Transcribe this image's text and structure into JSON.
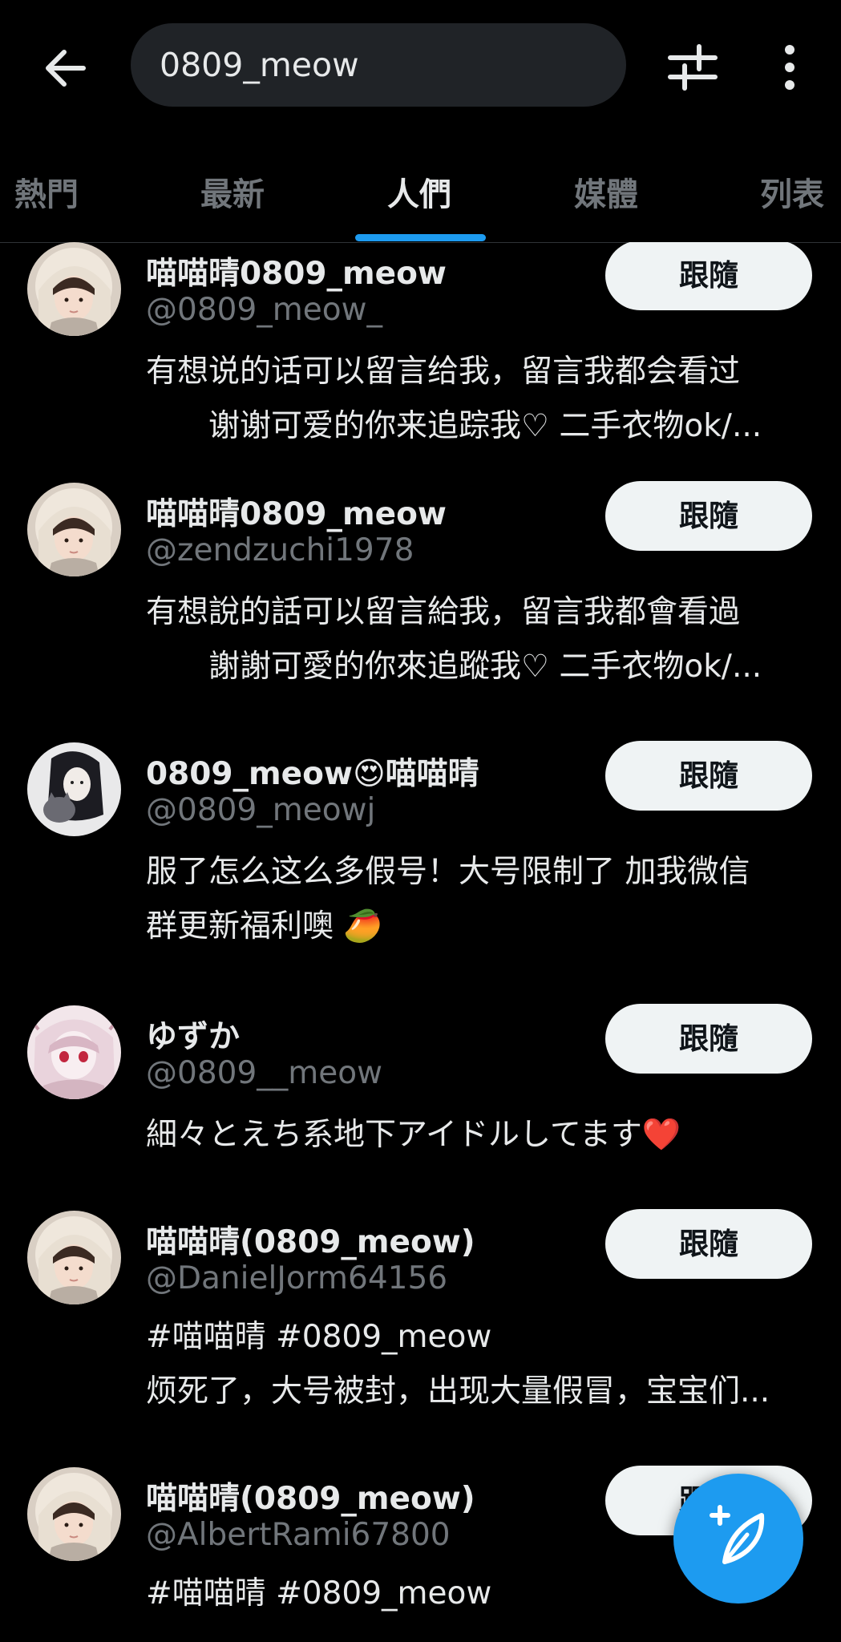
{
  "search": {
    "query": "0809_meow"
  },
  "tabs": [
    {
      "label": "熱門"
    },
    {
      "label": "最新"
    },
    {
      "label": "人們"
    },
    {
      "label": "媒體"
    },
    {
      "label": "列表"
    }
  ],
  "users": [
    {
      "name": "喵喵晴0809_meow",
      "handle": "@0809_meow_",
      "bio_line1": "有想说的话可以留言给我，留言我都会看过",
      "bio_line2": "谢谢可爱的你来追踪我♡ 二手衣物ok/...",
      "follow_label": "跟隨"
    },
    {
      "name": "喵喵晴0809_meow",
      "handle": "@zendzuchi1978",
      "bio_line1": "有想說的話可以留言給我，留言我都會看過",
      "bio_line2": "謝謝可愛的你來追蹤我♡ 二手衣物ok/...",
      "follow_label": "跟隨"
    },
    {
      "name": "0809_meow😍喵喵晴",
      "handle": "@0809_meowj",
      "bio_line1": "服了怎么这么多假号！大号限制了  加我微信",
      "bio_line2": "群更新福利噢 🥭",
      "follow_label": "跟隨"
    },
    {
      "name": "ゆずか",
      "handle": "@0809__meow",
      "bio_line1": "細々とえち系地下アイドルしてます❤️",
      "follow_label": "跟隨"
    },
    {
      "name": "喵喵晴(0809_meow)",
      "handle": "@DanielJorm64156",
      "bio_line1": "#喵喵晴 #0809_meow",
      "bio_line2": "烦死了，大号被封，出现大量假冒，宝宝们...",
      "follow_label": "跟隨"
    },
    {
      "name": "喵喵晴(0809_meow)",
      "handle": "@AlbertRami67800",
      "bio_line1": "#喵喵晴 #0809_meow",
      "follow_label": "跟隨"
    }
  ],
  "colors": {
    "accent": "#1d9bf0",
    "background": "#000000",
    "muted": "#71767b"
  },
  "icons": {
    "back": "arrow-left-icon",
    "filter": "sliders-icon",
    "more": "more-vertical-icon",
    "fab": "compose-feather-icon"
  }
}
